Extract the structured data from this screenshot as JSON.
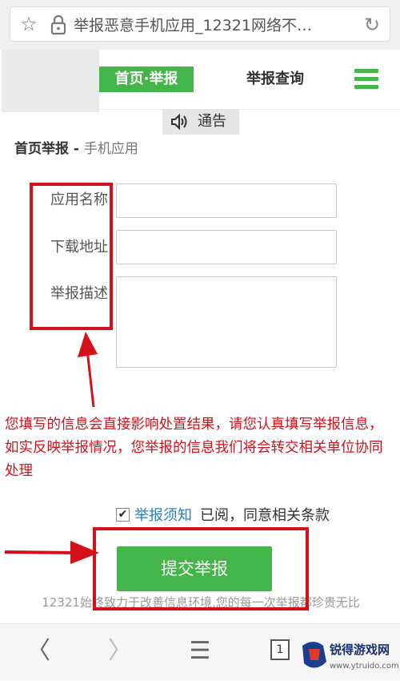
{
  "browser": {
    "url_text": "举报恶意手机应用_12321网络不…",
    "star_icon": "☆",
    "refresh_icon": "↻"
  },
  "nav": {
    "home_report": "首页·举报",
    "report_query": "举报查询"
  },
  "notice": {
    "label": "通告",
    "icon": "speaker-icon"
  },
  "breadcrumb": {
    "main": "首页举报",
    "separator": " - ",
    "sub": "手机应用"
  },
  "form": {
    "fields": [
      {
        "label": "应用名称",
        "value": ""
      },
      {
        "label": "下载地址",
        "value": ""
      },
      {
        "label": "举报描述",
        "value": ""
      }
    ]
  },
  "warning_text": "您填写的信息会直接影响处置结果，请您认真填写举报信息，如实反映举报情况，您举报的信息我们将会转交相关单位协同处理",
  "agreement": {
    "checked": true,
    "check_mark": "✔",
    "link_text": "举报须知",
    "text": "已阅，同意相关条款"
  },
  "submit_label": "提交举报",
  "slogan": "12321始终致力于改善信息环境,您的每一次举报都珍贵无比",
  "toolbar": {
    "back": "〈",
    "forward": "〉",
    "menu": "☰",
    "tab_count": "1"
  },
  "watermark": {
    "name": "锐得游戏网",
    "url": "www.ytruido.com"
  },
  "colors": {
    "accent_green": "#44b549",
    "annotation_red": "#d4101a",
    "link_blue": "#2a7fc0"
  }
}
